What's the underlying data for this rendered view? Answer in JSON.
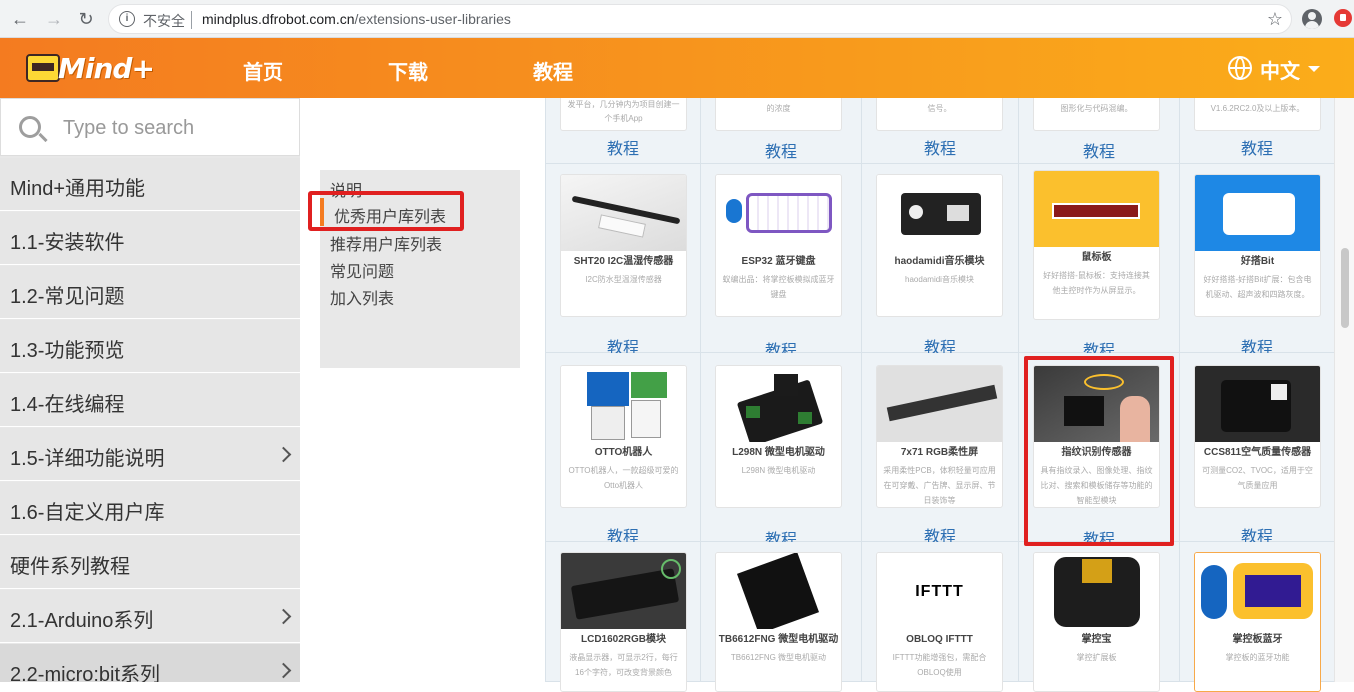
{
  "browser": {
    "insecure_label": "不安全",
    "url_domain": "mindplus.dfrobot.com.cn",
    "url_path": "/extensions-user-libraries",
    "back_glyph": "←",
    "forward_glyph": "→",
    "reload_glyph": "↻",
    "info_glyph": "i",
    "star_glyph": "☆"
  },
  "header": {
    "logo_text": "Mind+",
    "nav": [
      "首页",
      "下载",
      "教程"
    ],
    "lang_label": "中文",
    "colors": {
      "gradient_start": "#f47b20",
      "gradient_end": "#fbad1a"
    }
  },
  "sidebar": {
    "search_placeholder": "Type to search",
    "items": [
      {
        "label": "Mind+通用功能",
        "chevron": false
      },
      {
        "label": "1.1-安装软件",
        "chevron": false
      },
      {
        "label": "1.2-常见问题",
        "chevron": false
      },
      {
        "label": "1.3-功能预览",
        "chevron": false
      },
      {
        "label": "1.4-在线编程",
        "chevron": false
      },
      {
        "label": "1.5-详细功能说明",
        "chevron": true
      },
      {
        "label": "1.6-自定义用户库",
        "chevron": false
      },
      {
        "label": "硬件系列教程",
        "chevron": false
      },
      {
        "label": "2.1-Arduino系列",
        "chevron": true
      },
      {
        "label": "2.2-micro:bit系列",
        "chevron": true
      }
    ]
  },
  "toc": {
    "items": [
      "说明",
      "优秀用户库列表",
      "推荐用户库列表",
      "常见问题",
      "加入列表"
    ],
    "active_index": 1
  },
  "grid": {
    "tutorial_label": "教程",
    "top_fragments": [
      [
        "发平台，几分钟内为项目创建一",
        "个手机App"
      ],
      [
        "的浓度"
      ],
      [
        "信号。"
      ],
      [
        "图形化与代码混编。"
      ],
      [
        "V1.6.2RC2.0及以上版本。"
      ]
    ],
    "cards": [
      {
        "title": "SHT20 I2C温湿传感器",
        "desc": [
          "I2C防水型温湿传感器"
        ]
      },
      {
        "title": "ESP32 蓝牙键盘",
        "desc": [
          "蚁编出品：将掌控板模拟成蓝牙",
          "键盘"
        ]
      },
      {
        "title": "haodamidi音乐模块",
        "desc": [
          "haodamidi音乐模块"
        ]
      },
      {
        "title": "鼠标板",
        "desc": [
          "好好搭搭-鼠标板：支持连接其",
          "他主控时作为从屏显示。"
        ]
      },
      {
        "title": "好搭Bit",
        "desc": [
          "好好搭搭-好搭Bit扩展：包含电",
          "机驱动、超声波和四路灰度。"
        ]
      },
      {
        "title": "OTTO机器人",
        "desc": [
          "OTTO机器人，一款超级可爱的",
          "Otto机器人"
        ]
      },
      {
        "title": "L298N 微型电机驱动",
        "desc": [
          "L298N 微型电机驱动"
        ]
      },
      {
        "title": "7x71 RGB柔性屏",
        "desc": [
          "采用柔性PCB，体积轻量可应用",
          "在可穿戴、广告牌、显示屏、节",
          "日装饰等"
        ]
      },
      {
        "title": "指纹识别传感器",
        "desc": [
          "具有指纹录入、图像处理、指纹",
          "比对、搜索和模板储存等功能的",
          "智能型模块"
        ]
      },
      {
        "title": "CCS811空气质量传感器",
        "desc": [
          "可测量CO2、TVOC，适用于空",
          "气质量应用"
        ]
      },
      {
        "title": "LCD1602RGB模块",
        "desc": [
          "液晶显示器，可显示2行，每行",
          "16个字符，可改变背景颜色"
        ]
      },
      {
        "title": "TB6612FNG 微型电机驱动",
        "desc": [
          "TB6612FNG 微型电机驱动"
        ]
      },
      {
        "title": "OBLOQ IFTTT",
        "desc": [
          "IFTTT功能增强包，需配合",
          "OBLOQ使用"
        ]
      },
      {
        "title": "掌控宝",
        "desc": [
          "掌控扩展板"
        ]
      },
      {
        "title": "掌控板蓝牙",
        "desc": [
          "掌控板的蓝牙功能"
        ]
      }
    ],
    "ifttt_logo": "IFTTT"
  }
}
